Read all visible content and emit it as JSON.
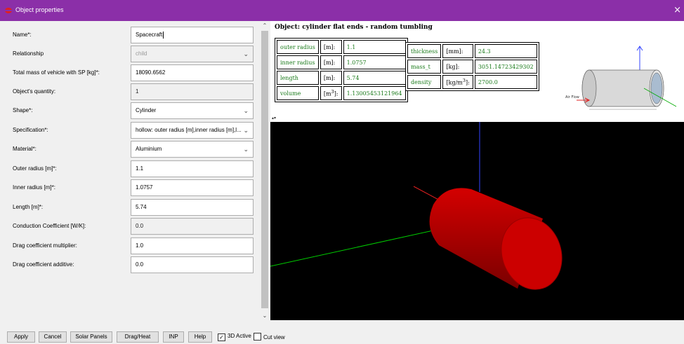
{
  "window": {
    "title": "Object properties",
    "close_icon": "×"
  },
  "form": {
    "rows": [
      {
        "label": "Name*:",
        "value": "Spacecraft",
        "state": "focused"
      },
      {
        "label": "Relationship",
        "value": "child",
        "state": "disabled-dropdown"
      },
      {
        "label": "Total mass of vehicle with SP [kg]*:",
        "value": "18090.6562",
        "state": "normal"
      },
      {
        "label": "Object's quantity:",
        "value": "1",
        "state": "disabled"
      },
      {
        "label": "Shape*:",
        "value": "Cylinder",
        "state": "dropdown"
      },
      {
        "label": "Specification*:",
        "value": "hollow: outer radius [m],inner radius [m],l...",
        "state": "dropdown"
      },
      {
        "label": "Material*:",
        "value": "Aluminium",
        "state": "dropdown"
      },
      {
        "label": "Outer radius [m]*:",
        "value": "1.1",
        "state": "normal"
      },
      {
        "label": "Inner radius [m]*:",
        "value": "1.0757",
        "state": "normal"
      },
      {
        "label": "Length [m]*:",
        "value": "5.74",
        "state": "normal"
      },
      {
        "label": "Conduction Coefficient [W/K]:",
        "value": "0.0",
        "state": "disabled"
      },
      {
        "label": "Drag coefficient multiplier:",
        "value": "1.0",
        "state": "normal"
      },
      {
        "label": "Drag coefficient additive:",
        "value": "0.0",
        "state": "normal"
      }
    ]
  },
  "object_info": {
    "title": "Object: cylinder flat ends - random tumbling",
    "table1": [
      {
        "name": "outer radius",
        "unit": "[m]:",
        "value": "1.1"
      },
      {
        "name": "inner radius",
        "unit": "[m]:",
        "value": "1.0757"
      },
      {
        "name": "length",
        "unit": "[m]:",
        "value": "5.74"
      },
      {
        "name": "volume",
        "unit": "[m",
        "unit_sup": "3",
        "unit_end": "]:",
        "value": "1.13005453121964"
      }
    ],
    "table2": [
      {
        "name": "thickness",
        "unit": "[mm]:",
        "value": "24.3"
      },
      {
        "name": "mass_t",
        "unit": "[kg]:",
        "value": "3051.14723429302"
      },
      {
        "name": "density",
        "unit": "[kg/m",
        "unit_sup": "3",
        "unit_end": "]:",
        "value": "2700.0"
      }
    ],
    "diagram_labels": {
      "air_flow": "Air Flow"
    }
  },
  "buttons": {
    "apply": "Apply",
    "cancel": "Cancel",
    "solar_panels": "Solar Panels",
    "drag_heat": "Drag/Heat",
    "inp": "INP",
    "help": "Help",
    "active_3d": "3D Active",
    "cut_view": "Cut view"
  },
  "checkboxes": {
    "active_3d_checked": true,
    "cut_view_checked": false
  },
  "colors": {
    "titlebar": "#8b2fa8",
    "cylinder": "#cc0000",
    "table_text": "#1a7a1a",
    "axis_x": "#00cc00",
    "axis_y": "#3344ff"
  }
}
